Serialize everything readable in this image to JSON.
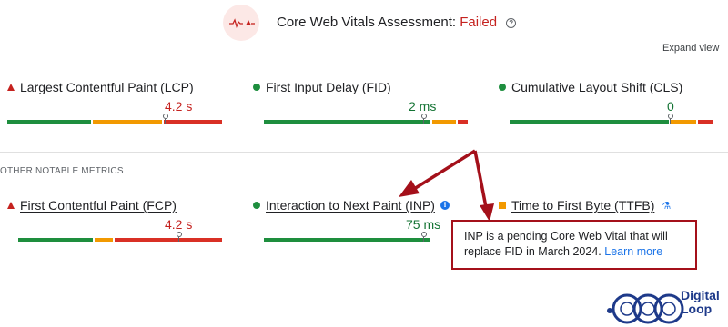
{
  "header": {
    "title": "Core Web Vitals Assessment:",
    "status": "Failed",
    "status_color": "#c5221f",
    "help_icon": "?",
    "expand_label": "Expand view"
  },
  "core_metrics": [
    {
      "label": "Largest Contentful Paint (LCP)",
      "value": "4.2 s",
      "rating": "poor",
      "indicator": "triangle",
      "marker": 0.74,
      "segments": [
        0.37,
        0.32,
        0.31
      ]
    },
    {
      "label": "First Input Delay (FID)",
      "value": "2 ms",
      "rating": "good",
      "indicator": "circle",
      "marker": 0.76,
      "segments": [
        0.78,
        0.12,
        0.1
      ]
    },
    {
      "label": "Cumulative Layout Shift (CLS)",
      "value": "0",
      "rating": "good",
      "indicator": "circle",
      "marker": 0.75,
      "segments": [
        0.78,
        0.12,
        0.1
      ]
    }
  ],
  "section_label": "OTHER NOTABLE METRICS",
  "other_metrics": [
    {
      "label": "First Contentful Paint (FCP)",
      "value": "4.2 s",
      "rating": "poor",
      "indicator": "triangle",
      "marker": 0.74,
      "segments": [
        0.35,
        0.09,
        0.56
      ]
    },
    {
      "label": "Interaction to Next Paint (INP)",
      "value": "75 ms",
      "rating": "good",
      "indicator": "circle",
      "marker": 0.76,
      "segments": [
        0.78,
        0.12,
        0.1
      ],
      "info_icon": "i"
    },
    {
      "label": "Time to First Byte (TTFB)",
      "value": "",
      "rating": "needs-improvement",
      "indicator": "square",
      "lab_icon": "⚗"
    }
  ],
  "tooltip": {
    "text": "INP is a pending Core Web Vital that will replace FID in March 2024.",
    "link": "Learn more",
    "border_color": "#a4101a"
  },
  "watermark": {
    "line1": "Digital",
    "line2": "Loop",
    "color": "#1e3a8a"
  },
  "colors": {
    "good": "#1e8e3e",
    "needs_improvement": "#f29900",
    "poor": "#d93025"
  }
}
